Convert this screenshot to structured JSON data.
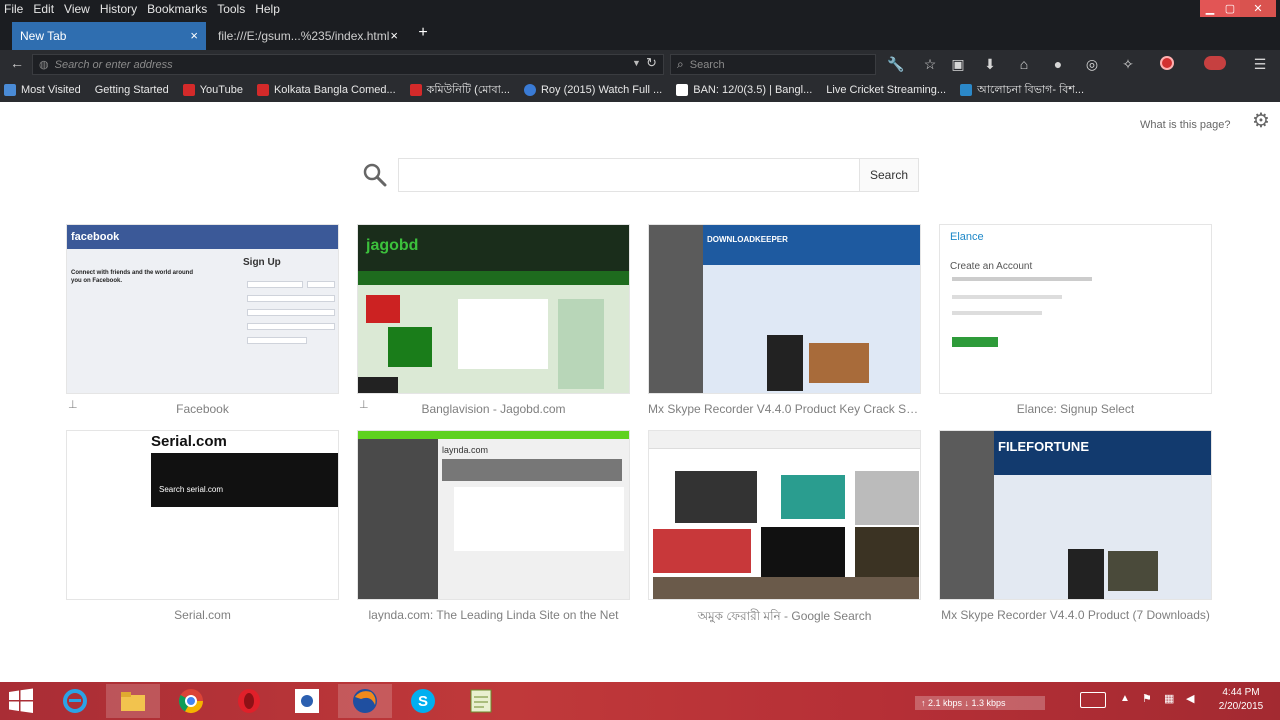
{
  "menubar": {
    "items": [
      "File",
      "Edit",
      "View",
      "History",
      "Bookmarks",
      "Tools",
      "Help"
    ]
  },
  "tabs": [
    {
      "label": "New Tab",
      "active": true
    },
    {
      "label": "file:///E:/gsum...%235/index.html",
      "active": false
    }
  ],
  "navbar": {
    "url_placeholder": "Search or enter address",
    "search_placeholder": "Search"
  },
  "bookmarks": [
    {
      "label": "Most Visited",
      "color": "#4a8bd6"
    },
    {
      "label": "Getting Started",
      "color": "#e86c1f"
    },
    {
      "label": "YouTube",
      "color": "#d42a2a"
    },
    {
      "label": "Kolkata Bangla Comed...",
      "color": "#d42a2a"
    },
    {
      "label": "কমিউনিটি (মোবা...",
      "color": "#d42a2a"
    },
    {
      "label": "Roy (2015) Watch Full ...",
      "color": "#3a7bd5"
    },
    {
      "label": "BAN: 12/0(3.5) | Bangl...",
      "color": "#222222"
    },
    {
      "label": "Live Cricket Streaming...",
      "color": "#2b88c8"
    },
    {
      "label": "আলোচনা বিভাগ- বিশ...",
      "color": "#2b88c8"
    }
  ],
  "content": {
    "what_is": "What is this page?",
    "search_button": "Search"
  },
  "tiles": [
    {
      "title": "Facebook",
      "pinned": true
    },
    {
      "title": "Banglavision - Jagobd.com",
      "pinned": true
    },
    {
      "title": "Mx Skype Recorder V4.4.0 Product Key Crack Se...",
      "pinned": false
    },
    {
      "title": "Elance: Signup Select",
      "pinned": false
    },
    {
      "title": "Serial.com",
      "pinned": false
    },
    {
      "title": "laynda.com: The Leading Linda Site on the Net",
      "pinned": false
    },
    {
      "title": "অমুক ফেরারী মনি - Google Search",
      "pinned": false
    },
    {
      "title": "Mx Skype Recorder V4.4.0 Product (7 Downloads)",
      "pinned": false
    }
  ],
  "thumb_text": {
    "facebook_logo": "facebook",
    "facebook_signup": "Sign Up",
    "facebook_tagline": "Connect with friends and the world around you on Facebook.",
    "jago_logo": "jagobd",
    "downloads_head": "DOWNLOADKEEPER",
    "elance_logo": "Elance",
    "elance_heading": "Create an Account",
    "serial_logo": "Serial.com",
    "serial_search": "Search serial.com",
    "laynda_logo": "laynda.com",
    "filefortune_logo": "FILEFORTUNE"
  },
  "taskbar": {
    "clock_time": "4:44 PM",
    "clock_date": "2/20/2015",
    "tray_text": "↑ 2.1 kbps  ↓ 1.3 kbps"
  }
}
